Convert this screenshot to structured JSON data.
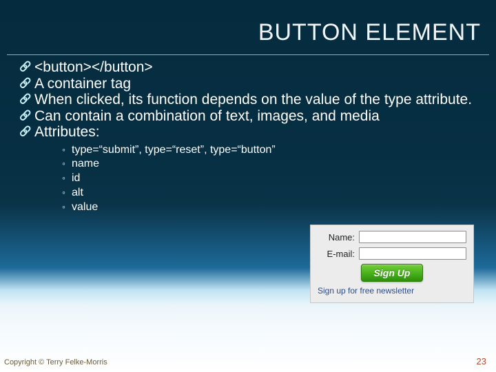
{
  "title": "BUTTON ELEMENT",
  "bullets": {
    "b1": "<button></button>",
    "b2": "A container tag",
    "b3": "When clicked, its function depends on the value of the type attribute.",
    "b4": "Can contain a combination of text, images, and media",
    "b5": "Attributes:"
  },
  "sub": {
    "s1": "type=“submit”,  type=“reset”,  type=“button”",
    "s2": "name",
    "s3": "id",
    "s4": "alt",
    "s5": "value"
  },
  "form": {
    "name_label": "Name:",
    "email_label": "E-mail:",
    "signup": "Sign Up",
    "caption": "Sign up for free newsletter"
  },
  "footer": {
    "copyright": "Copyright © Terry Felke-Morris",
    "page": "23"
  }
}
